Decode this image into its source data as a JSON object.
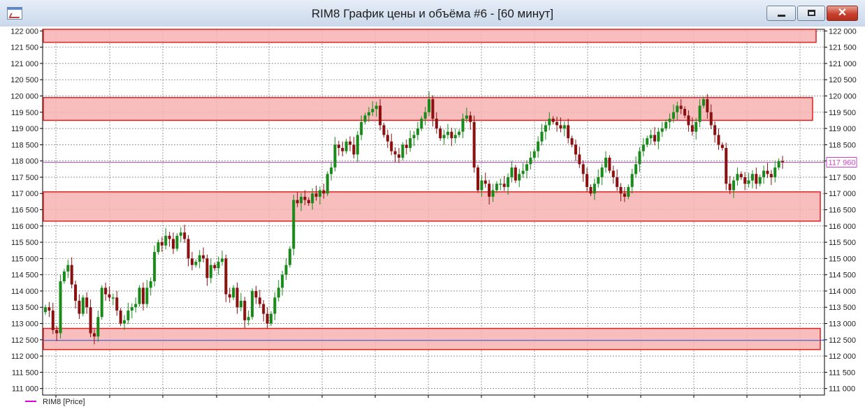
{
  "window": {
    "title": "RIM8 График цены и объёма #6 - [60 минут]",
    "controls": {
      "minimize_icon": "minimize-icon",
      "maximize_icon": "maximize-icon",
      "close_icon": "close-icon",
      "close_glyph": "✕"
    }
  },
  "chart_data": {
    "type": "candlestick",
    "ylim": [
      110800,
      122050
    ],
    "y_ticks": [
      "122 000",
      "121 500",
      "121 000",
      "120 500",
      "120 000",
      "119 500",
      "119 000",
      "118 500",
      "118 000",
      "117 500",
      "117 000",
      "116 500",
      "116 000",
      "115 500",
      "115 000",
      "114 500",
      "114 000",
      "113 500",
      "113 000",
      "112 500",
      "112 000",
      "111 500",
      "111 000"
    ],
    "y_tick_values": [
      122000,
      121500,
      121000,
      120500,
      120000,
      119500,
      119000,
      118500,
      118000,
      117500,
      117000,
      116500,
      116000,
      115500,
      115000,
      114500,
      114000,
      113500,
      113000,
      112500,
      112000,
      111500,
      111000
    ],
    "last_price_label": "117 960",
    "last_price": 117960,
    "legend_label": "RIM8 [Price]",
    "colors": {
      "up": "#1a8a1a",
      "down": "#8b1010",
      "zone_fill": "#f7b3b3",
      "zone_border": "#e02020",
      "price_line": "#cc44cc",
      "blue_line": "#3050d0",
      "grid": "#555555"
    },
    "horizontal_lines": [
      {
        "price": 117960,
        "color": "#cc44cc"
      },
      {
        "price": 112480,
        "color": "#3050d0"
      }
    ],
    "zones": [
      {
        "low": 121650,
        "high": 122050
      },
      {
        "low": 119250,
        "high": 119950
      },
      {
        "low": 116150,
        "high": 117050
      },
      {
        "low": 112200,
        "high": 112850
      }
    ],
    "close_series": [
      113500,
      113400,
      112800,
      112700,
      114300,
      114600,
      114800,
      114200,
      113700,
      113300,
      113800,
      113500,
      112700,
      112600,
      113200,
      114100,
      113900,
      113800,
      113800,
      113400,
      113000,
      113100,
      113400,
      113500,
      113600,
      114100,
      113600,
      114100,
      114300,
      115200,
      115500,
      115400,
      115700,
      115600,
      115300,
      115700,
      115800,
      115600,
      115000,
      114800,
      114900,
      115100,
      115000,
      114400,
      114800,
      114700,
      114900,
      115000,
      113900,
      113800,
      114100,
      113500,
      113700,
      113100,
      113200,
      114000,
      113800,
      113600,
      113300,
      113000,
      113300,
      113800,
      114100,
      114500,
      114800,
      115300,
      116800,
      116700,
      116900,
      116800,
      116700,
      117000,
      116900,
      117100,
      117000,
      117600,
      117800,
      118500,
      118400,
      118300,
      118600,
      118500,
      118200,
      118800,
      119200,
      119400,
      119500,
      119600,
      119700,
      119100,
      118800,
      118600,
      118300,
      118200,
      118100,
      118500,
      118400,
      118700,
      118800,
      119000,
      119300,
      119500,
      119900,
      119300,
      119000,
      118700,
      118800,
      118900,
      118700,
      118800,
      118900,
      119300,
      119400,
      119200,
      117800,
      117100,
      117400,
      117300,
      116900,
      117100,
      117300,
      117300,
      117200,
      117500,
      117800,
      117400,
      117600,
      117700,
      117900,
      118100,
      118300,
      118600,
      118900,
      119100,
      119300,
      119200,
      119100,
      119000,
      119100,
      118700,
      118500,
      118200,
      117900,
      117600,
      117200,
      117000,
      117300,
      117500,
      117800,
      118100,
      117700,
      117500,
      117200,
      117000,
      116900,
      117200,
      117600,
      117900,
      118300,
      118500,
      118700,
      118800,
      118600,
      118900,
      119000,
      119200,
      119300,
      119500,
      119700,
      119600,
      119400,
      119100,
      118900,
      119200,
      119700,
      119900,
      119500,
      119100,
      118800,
      118500,
      118400,
      117300,
      117100,
      117400,
      117600,
      117500,
      117300,
      117400,
      117600,
      117300,
      117500,
      117700,
      117600,
      117500,
      117800,
      118000,
      117960
    ]
  }
}
